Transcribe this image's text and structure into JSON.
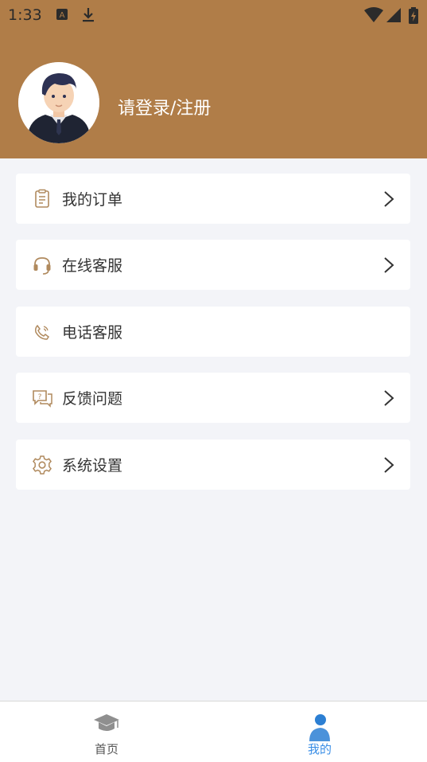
{
  "status_bar": {
    "time": "1:33"
  },
  "profile": {
    "login_text": "请登录/注册"
  },
  "menu": [
    {
      "label": "我的订单",
      "icon": "order-icon",
      "has_arrow": true
    },
    {
      "label": "在线客服",
      "icon": "headset-icon",
      "has_arrow": true
    },
    {
      "label": "电话客服",
      "icon": "phone-icon",
      "has_arrow": false
    },
    {
      "label": "反馈问题",
      "icon": "feedback-icon",
      "has_arrow": true
    },
    {
      "label": "系统设置",
      "icon": "gear-icon",
      "has_arrow": true
    }
  ],
  "tabbar": {
    "home_label": "首页",
    "mine_label": "我的"
  },
  "colors": {
    "header": "#b07d48",
    "icon_accent": "#b08a5e",
    "tab_active": "#3a8ee6",
    "background": "#f3f4f8"
  }
}
